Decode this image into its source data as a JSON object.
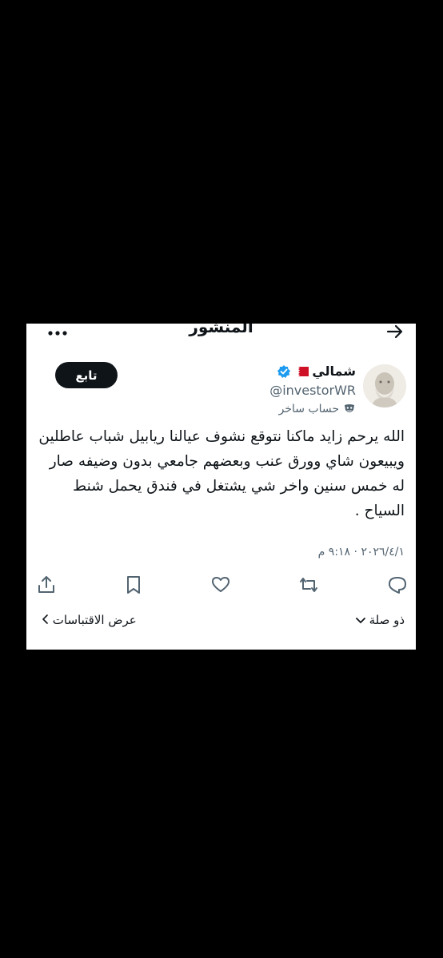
{
  "header": {
    "title": "المنشور",
    "back_icon": "arrow-right-icon",
    "more_icon": "more-horizontal-icon"
  },
  "author": {
    "display_name": "شمالي",
    "flag_icon": "bahrain-flag-icon",
    "verified_icon": "verified-badge-icon",
    "handle": "@investorWR",
    "parody_label": "حساب ساخر",
    "parody_icon": "theater-mask-icon"
  },
  "follow_button": {
    "label": "تابع"
  },
  "tweet": {
    "lines": [
      "الله يرحم زايد ماكنا نتوقع نشوف عيالنا ريابيل شباب عاطلين",
      "ويبيعون شاي وورق عنب وبعضهم جامعي بدون وضيفه صار",
      "له خمس سنين واخر شي يشتغل في فندق يحمل شنط",
      "السياح ."
    ],
    "timestamp": "٢٠٢٦/٤/١ · ٩:١٨ م"
  },
  "actions": [
    "reply-icon",
    "repost-icon",
    "like-icon",
    "bookmark-icon",
    "share-icon"
  ],
  "footer": {
    "relevant_label": "ذو صلة",
    "quotes_label": "عرض الاقتباسات"
  },
  "colors": {
    "accent": "#1d9bf0",
    "text": "#0f1419",
    "muted": "#536471",
    "flag_red": "#ce1126"
  }
}
